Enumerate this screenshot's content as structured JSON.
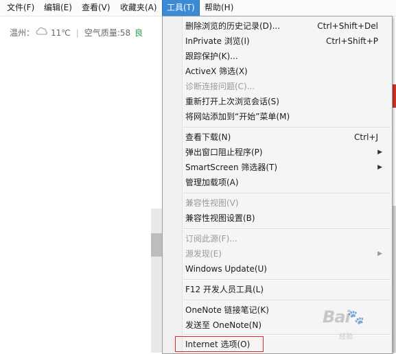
{
  "menubar": {
    "items": [
      "文件(F)",
      "编辑(E)",
      "查看(V)",
      "收藏夹(A)",
      "工具(T)",
      "帮助(H)"
    ]
  },
  "weather": {
    "city": "温州：",
    "temp": "11℃",
    "sep": "|",
    "aqi_label": "空气质量:58",
    "aqi_level": "良",
    "icon": "cloudy-icon"
  },
  "tools_menu": {
    "items": [
      {
        "label": "删除浏览的历史记录(D)...",
        "shortcut": "Ctrl+Shift+Del"
      },
      {
        "label": "InPrivate 浏览(I)",
        "shortcut": "Ctrl+Shift+P"
      },
      {
        "label": "跟踪保护(K)..."
      },
      {
        "label": "ActiveX 筛选(X)"
      },
      {
        "label": "诊断连接问题(C)...",
        "disabled": true
      },
      {
        "label": "重新打开上次浏览会话(S)"
      },
      {
        "label": "将网站添加到“开始”菜单(M)"
      },
      {
        "label": "查看下载(N)",
        "shortcut": "Ctrl+J"
      },
      {
        "label": "弹出窗口阻止程序(P)",
        "submenu": true
      },
      {
        "label": "SmartScreen 筛选器(T)",
        "submenu": true
      },
      {
        "label": "管理加载项(A)"
      },
      {
        "label": "兼容性视图(V)",
        "disabled": true
      },
      {
        "label": "兼容性视图设置(B)"
      },
      {
        "label": "订阅此源(F)...",
        "disabled": true
      },
      {
        "label": "源发现(E)",
        "disabled": true,
        "submenu": true
      },
      {
        "label": "Windows Update(U)"
      },
      {
        "label": "F12 开发人员工具(L)"
      },
      {
        "label": "OneNote 链接笔记(K)"
      },
      {
        "label": "发送至 OneNote(N)"
      },
      {
        "label": "Internet 选项(O)"
      }
    ],
    "submenu_arrow": "▶"
  },
  "watermark": {
    "text": "Bai",
    "paw": "🐾",
    "sub": "经验",
    "note": "watermark-logo"
  },
  "colors": {
    "menubar_active": "#3c8ad6",
    "highlight_box": "#e0272b",
    "aqi_good": "#2da141"
  }
}
